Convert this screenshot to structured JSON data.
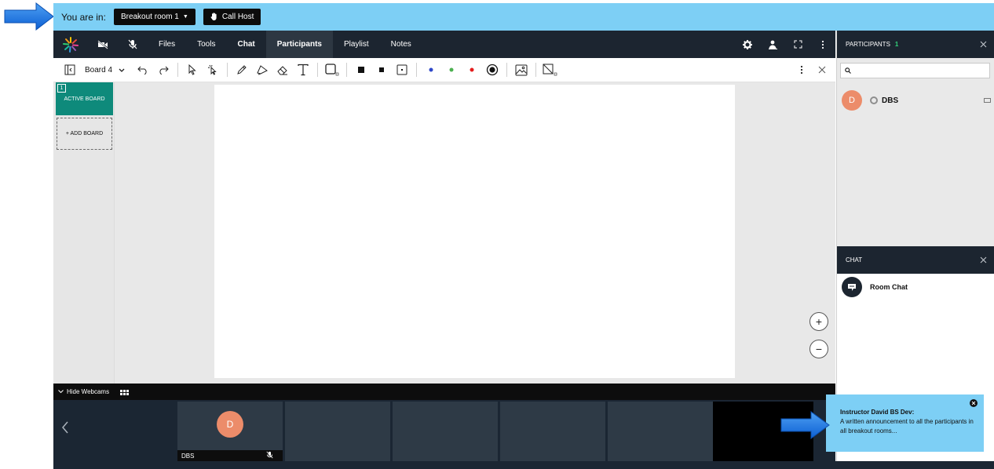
{
  "banner": {
    "label": "You are in:",
    "room_select": "Breakout room 1",
    "call_host": "Call Host"
  },
  "nav": {
    "items": [
      {
        "label": "Files"
      },
      {
        "label": "Tools"
      },
      {
        "label": "Chat"
      },
      {
        "label": "Participants"
      },
      {
        "label": "Playlist"
      },
      {
        "label": "Notes"
      }
    ]
  },
  "toolbar": {
    "board_select": "Board 4"
  },
  "boards": {
    "active_number": "1",
    "active_label": "ACTIVE BOARD",
    "add_label": "+ ADD BOARD"
  },
  "zoom": {
    "in": "+",
    "out": "−"
  },
  "webcams": {
    "hide_label": "Hide Webcams",
    "self_initial": "D",
    "self_name": "DBS"
  },
  "participants": {
    "title": "PARTICIPANTS",
    "count": "1",
    "list": [
      {
        "initial": "D",
        "name": "DBS"
      }
    ]
  },
  "chat": {
    "title": "CHAT",
    "room": "Room Chat"
  },
  "announcement": {
    "title": "Instructor David BS Dev:",
    "message": "A written announcement to all the participants in all breakout rooms..."
  },
  "colors": {
    "banner": "#7dcff5",
    "nav": "#1c2530",
    "active_board": "#0e8a7b",
    "avatar": "#ec8c6a",
    "count": "#33d17a",
    "arrow": "#1976e8"
  }
}
